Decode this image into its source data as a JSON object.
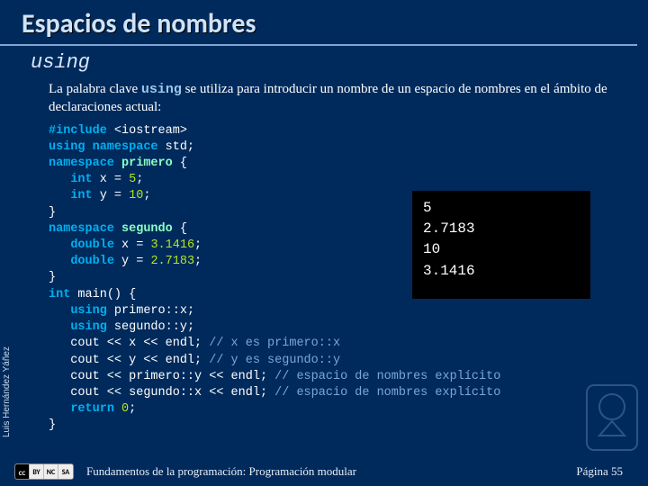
{
  "title": "Espacios de nombres",
  "subtitle": "using",
  "description": {
    "pre": "La palabra clave ",
    "keyword": "using",
    "post": " se utiliza para introducir un nombre de un espacio de nombres en el ámbito de declaraciones actual:"
  },
  "code": {
    "l01a": "#include",
    "l01b": " <iostream>",
    "l02a": "using namespace",
    "l02b": " std;",
    "l03a": "namespace",
    "l03b": " primero",
    "l03c": " {",
    "l04a": "   ",
    "l04b": "int",
    "l04c": " x = ",
    "l04d": "5",
    "l04e": ";",
    "l05a": "   ",
    "l05b": "int",
    "l05c": " y = ",
    "l05d": "10",
    "l05e": ";",
    "l06": "}",
    "l07a": "namespace",
    "l07b": " segundo",
    "l07c": " {",
    "l08a": "   ",
    "l08b": "double",
    "l08c": " x = ",
    "l08d": "3.1416",
    "l08e": ";",
    "l09a": "   ",
    "l09b": "double",
    "l09c": " y = ",
    "l09d": "2.7183",
    "l09e": ";",
    "l10": "}",
    "l11a": "int",
    "l11b": " main() {",
    "l12a": "   ",
    "l12b": "using",
    "l12c": " primero::x;",
    "l13a": "   ",
    "l13b": "using",
    "l13c": " segundo::y;",
    "l14a": "   cout << x << endl; ",
    "l14b": "// x es primero::x",
    "l15a": "   cout << y << endl; ",
    "l15b": "// y es segundo::y",
    "l16a": "   cout << primero::y << endl; ",
    "l16b": "// espacio de nombres explícito",
    "l17a": "   cout << segundo::x << endl; ",
    "l17b": "// espacio de nombres explícito",
    "l18a": "   ",
    "l18b": "return",
    "l18c": " ",
    "l18d": "0",
    "l18e": ";",
    "l19": "}"
  },
  "output": "5\n2.7183\n10\n3.1416",
  "author": "Luis Hernández Yáñez",
  "footer_text": "Fundamentos de la programación: Programación modular",
  "page_label": "Página 55",
  "cc": {
    "a": "CC",
    "b": "BY",
    "c": "NC",
    "d": "SA"
  }
}
